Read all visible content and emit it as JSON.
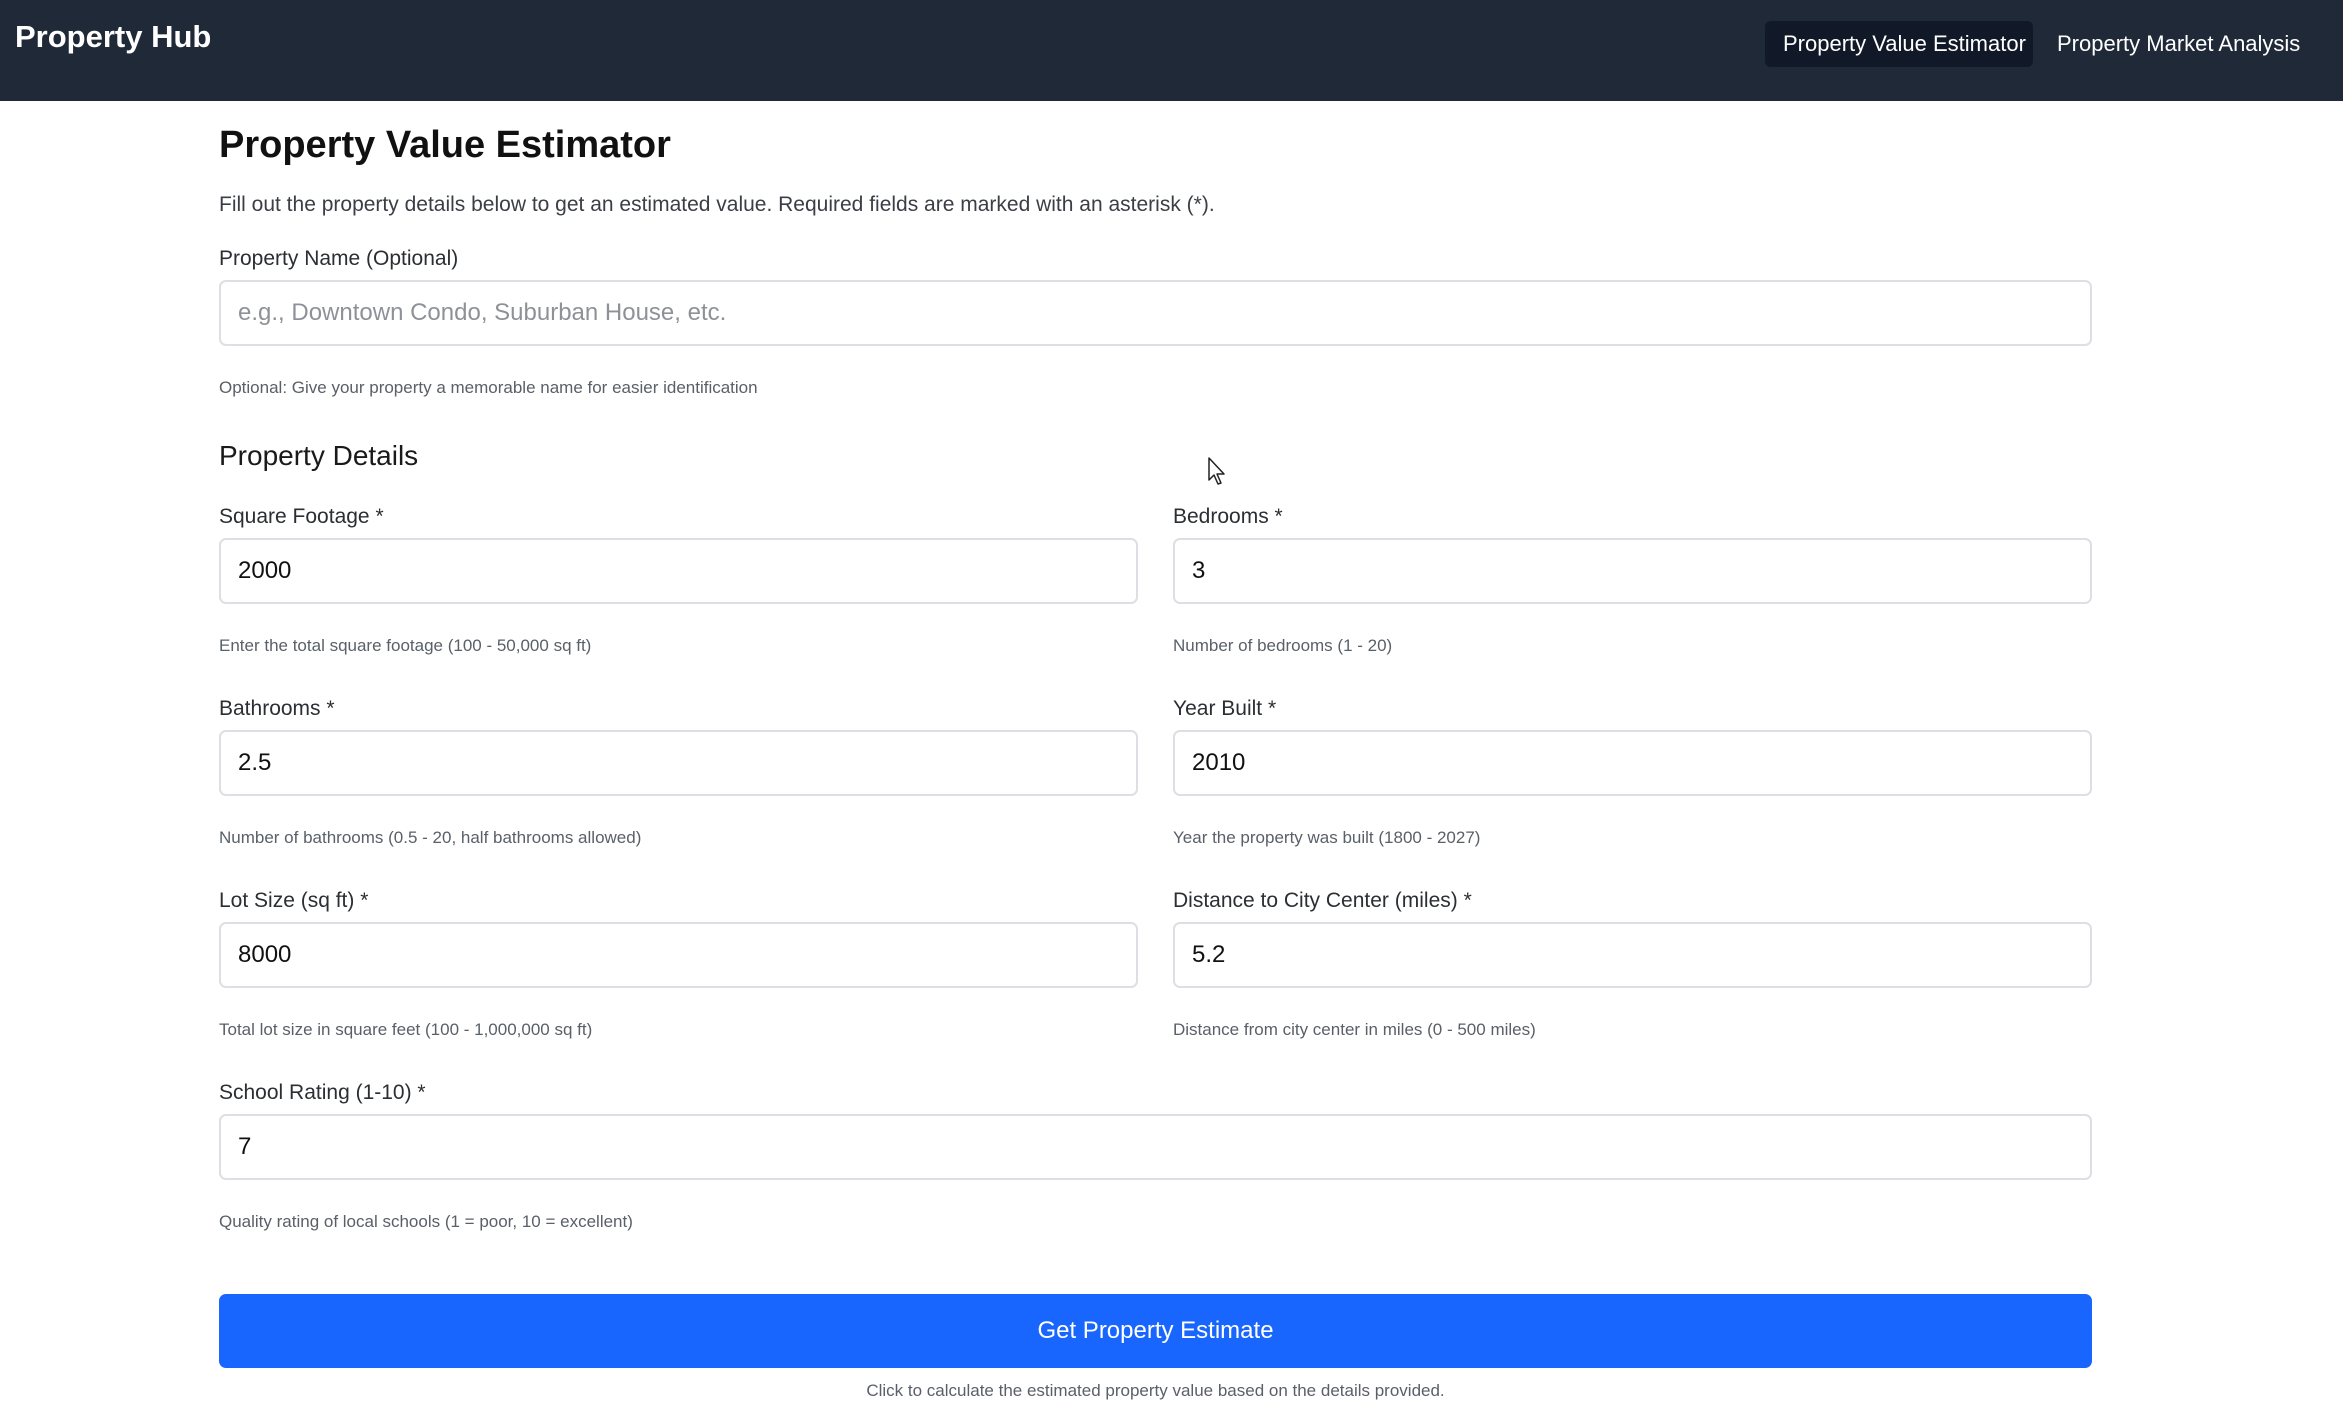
{
  "header": {
    "brand": "Property Hub",
    "nav": [
      {
        "label": "Property Value Estimator",
        "active": true
      },
      {
        "label": "Property Market Analysis",
        "active": false
      }
    ]
  },
  "page": {
    "title": "Property Value Estimator",
    "intro": "Fill out the property details below to get an estimated value. Required fields are marked with an asterisk (*)."
  },
  "property_name": {
    "label": "Property Name (Optional)",
    "placeholder": "e.g., Downtown Condo, Suburban House, etc.",
    "value": "",
    "help": "Optional: Give your property a memorable name for easier identification"
  },
  "details_heading": "Property Details",
  "fields": {
    "square_footage": {
      "label": "Square Footage *",
      "value": "2000",
      "help": "Enter the total square footage (100 - 50,000 sq ft)"
    },
    "bedrooms": {
      "label": "Bedrooms *",
      "value": "3",
      "help": "Number of bedrooms (1 - 20)"
    },
    "bathrooms": {
      "label": "Bathrooms *",
      "value": "2.5",
      "help": "Number of bathrooms (0.5 - 20, half bathrooms allowed)"
    },
    "year_built": {
      "label": "Year Built *",
      "value": "2010",
      "help": "Year the property was built (1800 - 2027)"
    },
    "lot_size": {
      "label": "Lot Size (sq ft) *",
      "value": "8000",
      "help": "Total lot size in square feet (100 - 1,000,000 sq ft)"
    },
    "distance": {
      "label": "Distance to City Center (miles) *",
      "value": "5.2",
      "help": "Distance from city center in miles (0 - 500 miles)"
    },
    "school_rating": {
      "label": "School Rating (1-10) *",
      "value": "7",
      "help": "Quality rating of local schools (1 = poor, 10 = excellent)"
    }
  },
  "submit": {
    "label": "Get Property Estimate",
    "hint": "Click to calculate the estimated property value based on the details provided."
  },
  "colors": {
    "header_bg": "#1f2937",
    "accent": "#1866fd"
  }
}
